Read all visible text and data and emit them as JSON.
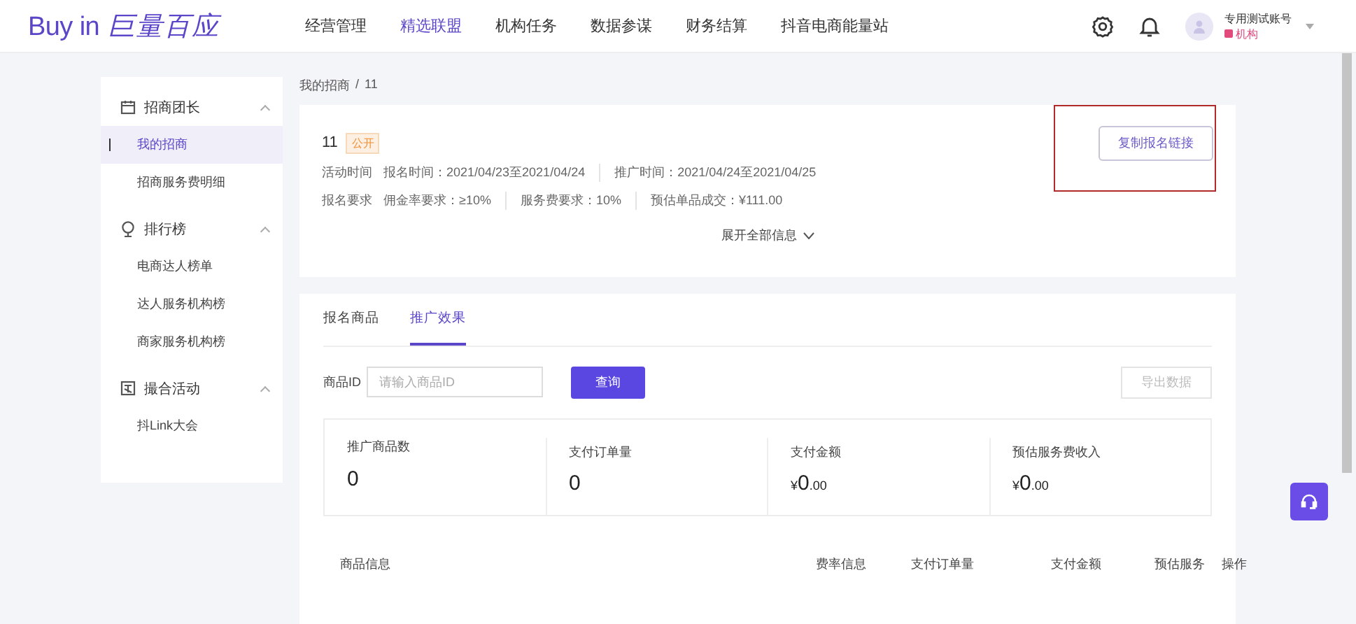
{
  "header": {
    "logo": {
      "latin": "Buy in",
      "cjk": "巨量百应"
    },
    "nav": [
      {
        "label": "经营管理",
        "selected": false
      },
      {
        "label": "精选联盟",
        "selected": true
      },
      {
        "label": "机构任务",
        "selected": false
      },
      {
        "label": "数据参谋",
        "selected": false
      },
      {
        "label": "财务结算",
        "selected": false
      },
      {
        "label": "抖音电商能量站",
        "selected": false
      }
    ],
    "user": {
      "name": "专用测试账号",
      "role": "机构"
    }
  },
  "sidebar": {
    "groups": [
      {
        "title": "招商团长",
        "expanded": true,
        "items": [
          {
            "label": "我的招商",
            "selected": true
          },
          {
            "label": "招商服务费明细",
            "selected": false
          }
        ]
      },
      {
        "title": "排行榜",
        "expanded": true,
        "items": [
          {
            "label": "电商达人榜单",
            "selected": false
          },
          {
            "label": "达人服务机构榜",
            "selected": false
          },
          {
            "label": "商家服务机构榜",
            "selected": false
          }
        ]
      },
      {
        "title": "撮合活动",
        "expanded": true,
        "items": [
          {
            "label": "抖Link大会",
            "selected": false
          }
        ]
      }
    ]
  },
  "breadcrumb": {
    "items": [
      "我的招商",
      "11"
    ],
    "separator": "/"
  },
  "campaign": {
    "title": "11",
    "tag": "公开",
    "rows": [
      {
        "label": "活动时间",
        "fields": [
          "报名时间：2021/04/23至2021/04/24",
          "推广时间：2021/04/24至2021/04/25"
        ]
      },
      {
        "label": "报名要求",
        "fields": [
          "佣金率要求：≥10%",
          "服务费要求：10%",
          "预估单品成交：¥111.00"
        ]
      }
    ],
    "expand": "展开全部信息",
    "copy_button": "复制报名链接"
  },
  "tabs": [
    {
      "label": "报名商品",
      "selected": false
    },
    {
      "label": "推广效果",
      "selected": true
    }
  ],
  "filter": {
    "label": "商品ID",
    "placeholder": "请输入商品ID",
    "query_button": "查询",
    "export_button": {
      "label": "导出数据",
      "disabled": true
    }
  },
  "stats": [
    {
      "label": "推广商品数",
      "value": {
        "integer": "0"
      }
    },
    {
      "label": "支付订单量",
      "value": {
        "integer": "0"
      }
    },
    {
      "label": "支付金额",
      "value": {
        "currency": "¥",
        "integer": "0",
        "decimal": ".00"
      }
    },
    {
      "label": "预估服务费收入",
      "value": {
        "currency": "¥",
        "integer": "0",
        "decimal": ".00"
      }
    }
  ],
  "table": {
    "columns": [
      "商品信息",
      "费率信息",
      "支付订单量",
      "支付金额",
      "预估服务",
      "操作"
    ]
  }
}
